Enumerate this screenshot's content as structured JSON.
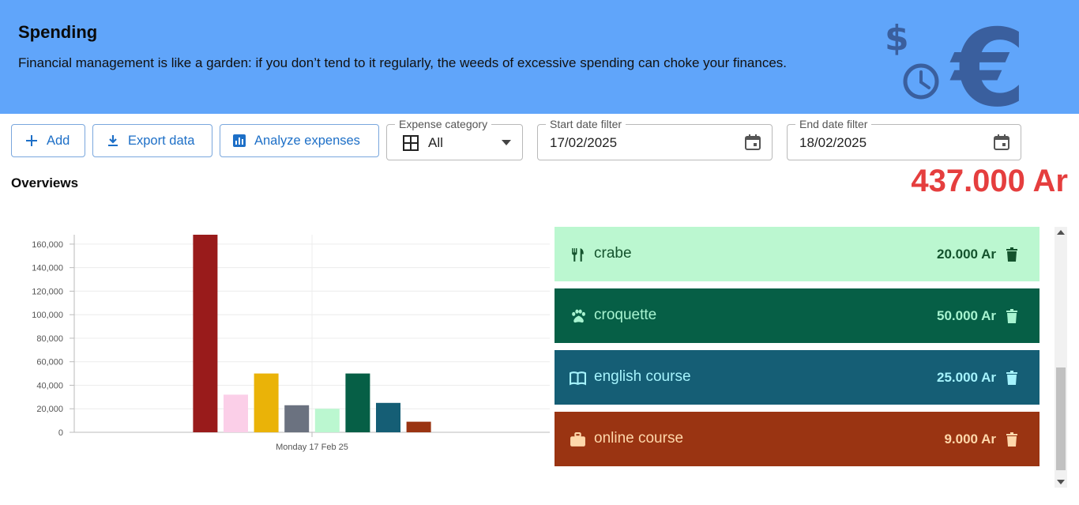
{
  "header": {
    "title": "Spending",
    "quote": "Financial management is like a garden: if you don’t tend to it regularly, the weeds of excessive spending can choke your finances."
  },
  "toolbar": {
    "add_label": "Add",
    "export_label": "Export data",
    "analyze_label": "Analyze expenses"
  },
  "filters": {
    "category": {
      "label": "Expense category",
      "value": "All"
    },
    "start_date": {
      "label": "Start date filter",
      "value": "17/02/2025"
    },
    "end_date": {
      "label": "End date filter",
      "value": "18/02/2025"
    }
  },
  "overview": {
    "title": "Overviews",
    "total": "437.000 Ar"
  },
  "expenses": [
    {
      "name": "crabe",
      "amount": "20.000 Ar",
      "icon": "utensils-icon",
      "bg": "#bbf7d0",
      "fg": "#14532d"
    },
    {
      "name": "croquette",
      "amount": "50.000 Ar",
      "icon": "paw-icon",
      "bg": "#065f46",
      "fg": "#a7f3d0"
    },
    {
      "name": "english course",
      "amount": "25.000 Ar",
      "icon": "book-icon",
      "bg": "#155e75",
      "fg": "#a5f3fc"
    },
    {
      "name": "online course",
      "amount": "9.000 Ar",
      "icon": "briefcase-icon",
      "bg": "#9a3412",
      "fg": "#fed7aa"
    }
  ],
  "chart_data": {
    "type": "bar",
    "categories": [
      "Monday 17 Feb 25"
    ],
    "series": [
      {
        "values": [
          168000
        ],
        "color": "#991b1b"
      },
      {
        "values": [
          32000
        ],
        "color": "#fbcfe8"
      },
      {
        "values": [
          50000
        ],
        "color": "#eab308"
      },
      {
        "values": [
          23000
        ],
        "color": "#6b7280"
      },
      {
        "values": [
          20000
        ],
        "color": "#bbf7d0"
      },
      {
        "values": [
          50000
        ],
        "color": "#065f46"
      },
      {
        "values": [
          25000
        ],
        "color": "#155e75"
      },
      {
        "values": [
          9000
        ],
        "color": "#9a3412"
      }
    ],
    "yticks": [
      "0",
      "20,000",
      "40,000",
      "60,000",
      "80,000",
      "100,000",
      "120,000",
      "140,000",
      "160,000"
    ],
    "ylim": [
      0,
      168000
    ],
    "grid": true,
    "legend": "none"
  }
}
